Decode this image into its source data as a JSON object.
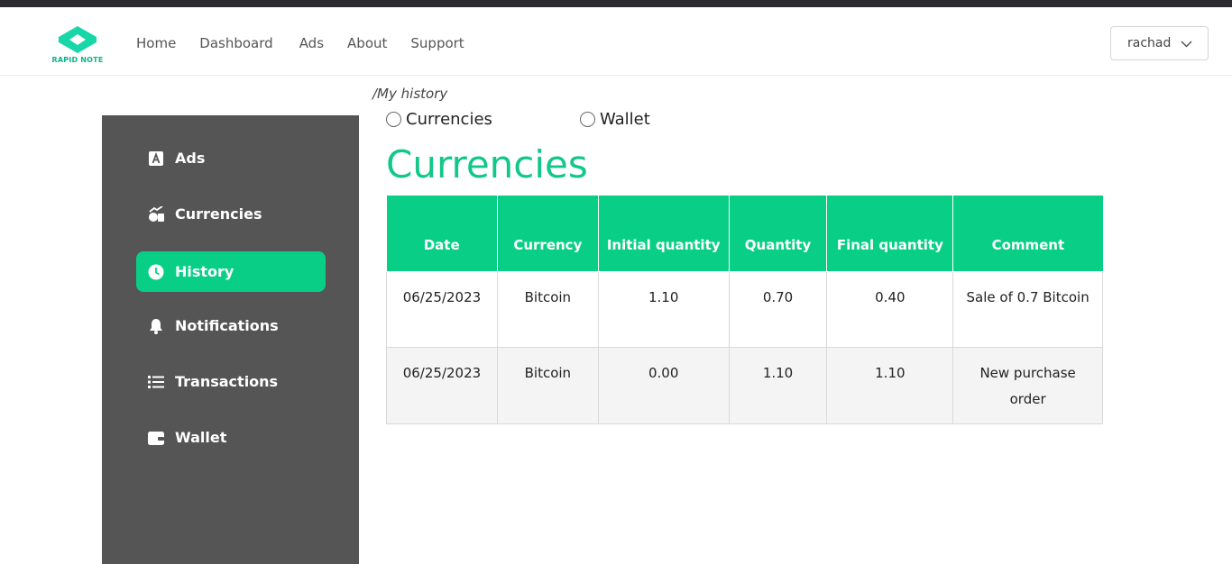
{
  "brand": {
    "name": "RAPID NOTE",
    "color": "#0bb386"
  },
  "nav": {
    "links": [
      "Home",
      "Dashboard",
      "Ads",
      "About",
      "Support"
    ]
  },
  "user": {
    "name": "rachad"
  },
  "breadcrumb": "/My history",
  "sidebar": {
    "items": [
      {
        "label": "Ads",
        "icon": "ads-icon",
        "active": false
      },
      {
        "label": "Currencies",
        "icon": "currencies-icon",
        "active": false
      },
      {
        "label": "History",
        "icon": "clock-icon",
        "active": true
      },
      {
        "label": "Notifications",
        "icon": "bell-icon",
        "active": false
      },
      {
        "label": "Transactions",
        "icon": "list-icon",
        "active": false
      },
      {
        "label": "Wallet",
        "icon": "wallet-icon",
        "active": false
      }
    ]
  },
  "filter": {
    "options": [
      "Currencies",
      "Wallet"
    ]
  },
  "section": {
    "title": "Currencies"
  },
  "table": {
    "headers": [
      "Date",
      "Currency",
      "Initial quantity",
      "Quantity",
      "Final quantity",
      "Comment"
    ],
    "rows": [
      [
        "06/25/2023",
        "Bitcoin",
        "1.10",
        "0.70",
        "0.40",
        "Sale of 0.7 Bitcoin"
      ],
      [
        "06/25/2023",
        "Bitcoin",
        "0.00",
        "1.10",
        "1.10",
        "New purchase order"
      ]
    ]
  },
  "colors": {
    "accent": "#09cf86",
    "sidebar": "#555555",
    "title": "#11c889"
  }
}
